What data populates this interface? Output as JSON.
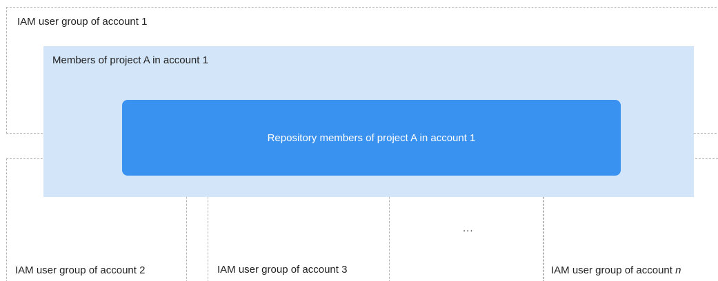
{
  "groups": {
    "account1": "IAM user group of account 1",
    "account2": "IAM user group of account 2",
    "account3": "IAM user group of account 3",
    "ellipsis": "...",
    "accountn_prefix": "IAM user group of account ",
    "accountn_var": "n"
  },
  "members_label": "Members of project A in account 1",
  "repo_label": "Repository members of project A in account 1",
  "colors": {
    "members_bg": "#d3e5f9",
    "repo_bg": "#3a92f0",
    "dashed_border": "#b5b5b5"
  }
}
